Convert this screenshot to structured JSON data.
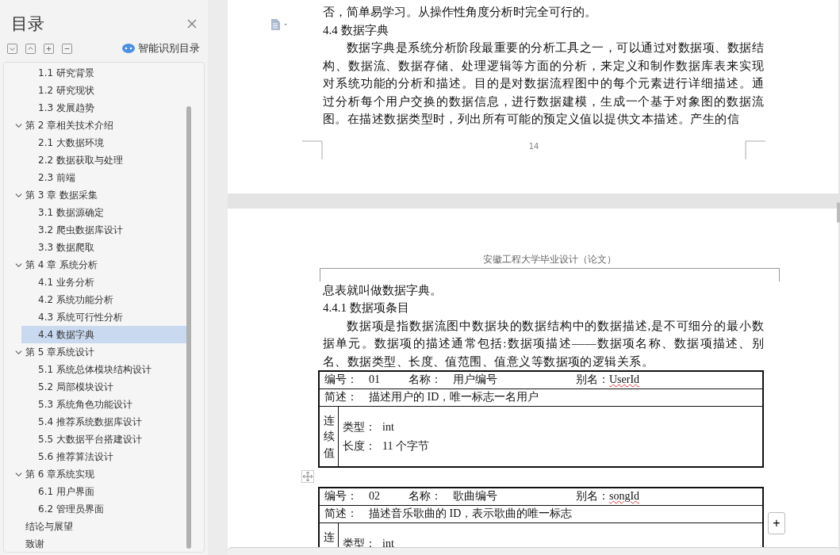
{
  "sidebar": {
    "title": "目录",
    "smart_button": "智能识别目录",
    "toc": [
      {
        "children": [
          {
            "label": "1.1  研究背景",
            "selected": false
          },
          {
            "label": "1.2  研究现状",
            "selected": false
          },
          {
            "label": "1.3  发展趋势",
            "selected": false
          }
        ]
      },
      {
        "label": "第 2 章相关技术介绍",
        "expanded": true,
        "children": [
          {
            "label": "2.1  大数据环境",
            "selected": false
          },
          {
            "label": "2.2  数据获取与处理",
            "selected": false
          },
          {
            "label": "2.3 前端",
            "selected": false
          }
        ]
      },
      {
        "label": "第 3 章  数据采集",
        "expanded": true,
        "children": [
          {
            "label": "3.1  数据源确定",
            "selected": false
          },
          {
            "label": "3.2  爬虫数据库设计",
            "selected": false
          },
          {
            "label": "3.3  数据爬取",
            "selected": false
          }
        ]
      },
      {
        "label": "第 4 章  系统分析",
        "expanded": true,
        "children": [
          {
            "label": "4.1  业务分析",
            "selected": false
          },
          {
            "label": "4.2  系统功能分析",
            "selected": false
          },
          {
            "label": "4.3  系统可行性分析",
            "selected": false
          },
          {
            "label": "4.4  数据字典",
            "selected": true
          }
        ]
      },
      {
        "label": "第 5 章系统设计",
        "expanded": true,
        "children": [
          {
            "label": "5.1  系统总体模块结构设计",
            "selected": false
          },
          {
            "label": "5.2  局部模块设计",
            "selected": false
          },
          {
            "label": "5.3  系统角色功能设计",
            "selected": false
          },
          {
            "label": "5.4  推荐系统数据库设计",
            "selected": false
          },
          {
            "label": "5.5  大数据平台搭建设计",
            "selected": false
          },
          {
            "label": "5.6  推荐算法设计",
            "selected": false
          }
        ]
      },
      {
        "label": "第 6 章系统实现",
        "expanded": true,
        "children": [
          {
            "label": "6.1  用户界面",
            "selected": false
          },
          {
            "label": "6.2  管理员界面",
            "selected": false
          }
        ]
      },
      {
        "label": "结论与展望",
        "selected": false
      },
      {
        "label": "致谢",
        "selected": false
      }
    ]
  },
  "page1": {
    "top_line": "否，简单易学习。从操作性角度分析时完全可行的。",
    "heading": "4.4  数据字典",
    "paragraph": "数据字典是系统分析阶段最重要的分析工具之一，可以通过对数据项、数据结构、数据流、数据存储、处理逻辑等方面的分析，来定义和制作数据库表来实现对系统功能的分析和描述。目的是对数据流程图中的每个元素进行详细描述。通过分析每个用户交换的数据信息，进行数据建模，生成一个基于对象图的数据流图。在描述数据类型时，列出所有可能的预定义值以提供文本描述。产生的信",
    "page_number": "14"
  },
  "page2": {
    "add_button": "+",
    "header": "安徽工程大学毕业设计（论文）",
    "continuation": "息表就叫做数据字典。",
    "subheading": "4.4.1 数据项条目",
    "paragraph": "数据项是指数据流图中数据块的数据结构中的数据描述,是不可细分的最小数据单元。数据项的描述通常包括:数据项描述——数据项名称、数据项描述、别名、数据类型、长度、值范围、值意义等数据项的逻辑关系。",
    "tables": [
      {
        "number_label": "编号：",
        "number": "01",
        "name_label": "名称：",
        "name": "用户编号",
        "alias_label": "别名：",
        "alias": "UserId",
        "flagged": true,
        "summary_label": "简述：",
        "summary": "描述用户的 ID，唯一标志一名用户",
        "values_label": "连续值",
        "values": [
          {
            "label": "类型：",
            "value": "int"
          },
          {
            "label": "长度：",
            "value": "11 个字节"
          }
        ]
      },
      {
        "number_label": "编号：",
        "number": "02",
        "name_label": "名称：",
        "name": "歌曲编号",
        "alias_label": "别名：",
        "alias": "songId",
        "flagged": true,
        "summary_label": "简述：",
        "summary": "描述音乐歌曲的 ID，表示歌曲的唯一标志",
        "values_label": "连",
        "values": [
          {
            "label": "类型：",
            "value": "int"
          }
        ]
      }
    ]
  }
}
